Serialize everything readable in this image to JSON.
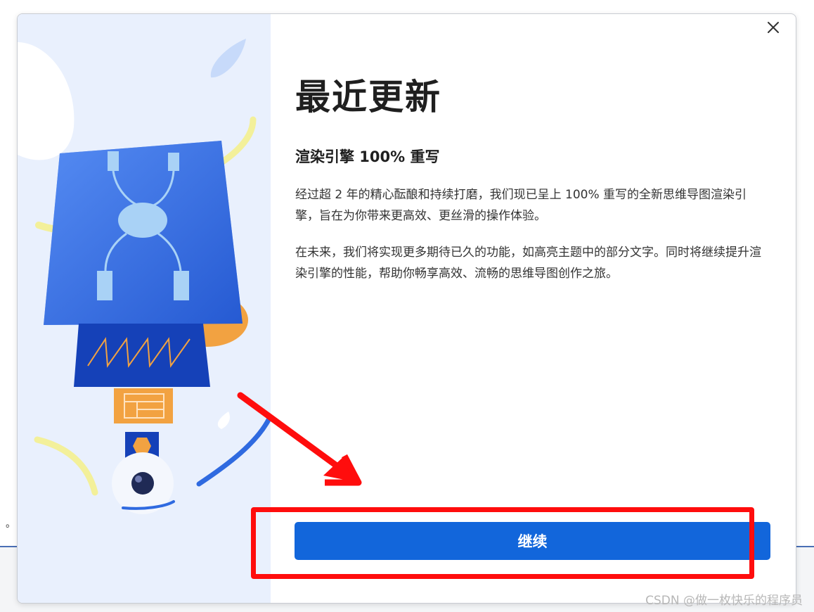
{
  "dialog": {
    "title": "最近更新",
    "subtitle": "渲染引擎 100% 重写",
    "paragraphs": [
      "经过超 2 年的精心酝酿和持续打磨，我们现已呈上 100% 重写的全新思维导图渲染引擎，旨在为你带来更高效、更丝滑的操作体验。",
      "在未来，我们将实现更多期待已久的功能，如高亮主题中的部分文字。同时将继续提升渲染引擎的性能，帮助你畅享高效、流畅的思维导图创作之旅。"
    ],
    "continue_label": "继续",
    "close_icon": "close-icon"
  },
  "background": {
    "stray_char": "。"
  },
  "watermark": "CSDN @做一枚快乐的程序员",
  "colors": {
    "primary_button": "#1266db",
    "annotation": "#ff0d0d",
    "illustration_bg": "#e9f0fd"
  }
}
